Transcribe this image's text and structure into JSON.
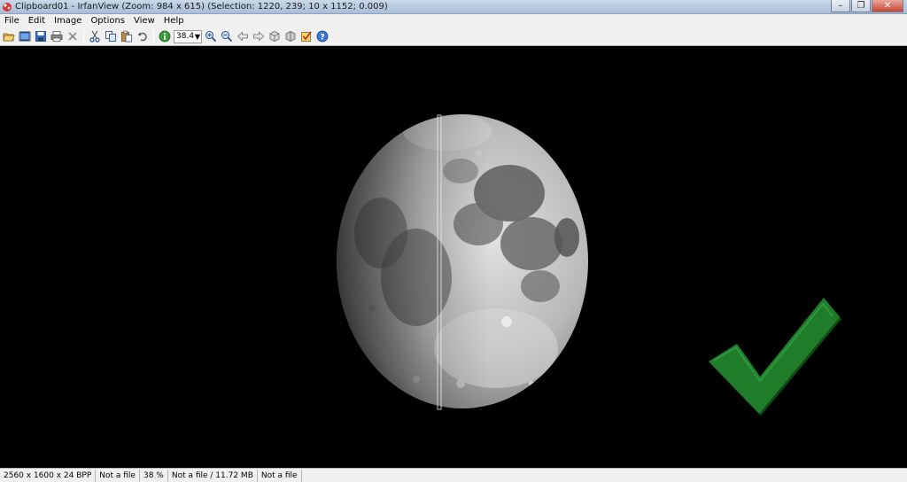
{
  "window": {
    "title": "Clipboard01 - IrfanView (Zoom: 984 x 615) (Selection: 1220, 239; 10 x 1152; 0.009)",
    "minimize_glyph": "–",
    "maximize_glyph": "❐",
    "close_glyph": "✕"
  },
  "menu": {
    "items": [
      "File",
      "Edit",
      "Image",
      "Options",
      "View",
      "Help"
    ]
  },
  "toolbar": {
    "zoom_value": "38.4",
    "buttons": [
      "open-folder-icon",
      "slideshow-icon",
      "save-icon",
      "print-icon",
      "delete-icon",
      "cut-icon",
      "copy-icon",
      "paste-icon",
      "undo-icon",
      "info-icon",
      "zoom-in-icon",
      "zoom-out-icon",
      "previous-icon",
      "next-icon",
      "first-icon",
      "last-icon",
      "properties-icon",
      "help-icon"
    ]
  },
  "colors": {
    "checkmark": "#1f7d2a",
    "checkmark_dark": "#0f4a14",
    "moon_light": "#d7d7d7",
    "moon_dark": "#6a6a6a",
    "selection_line": "#e8e8e8"
  },
  "status": {
    "cells": [
      "2560 x 1600 x 24 BPP",
      "Not a file",
      "38 %",
      "Not a file / 11.72 MB",
      "Not a file"
    ]
  }
}
